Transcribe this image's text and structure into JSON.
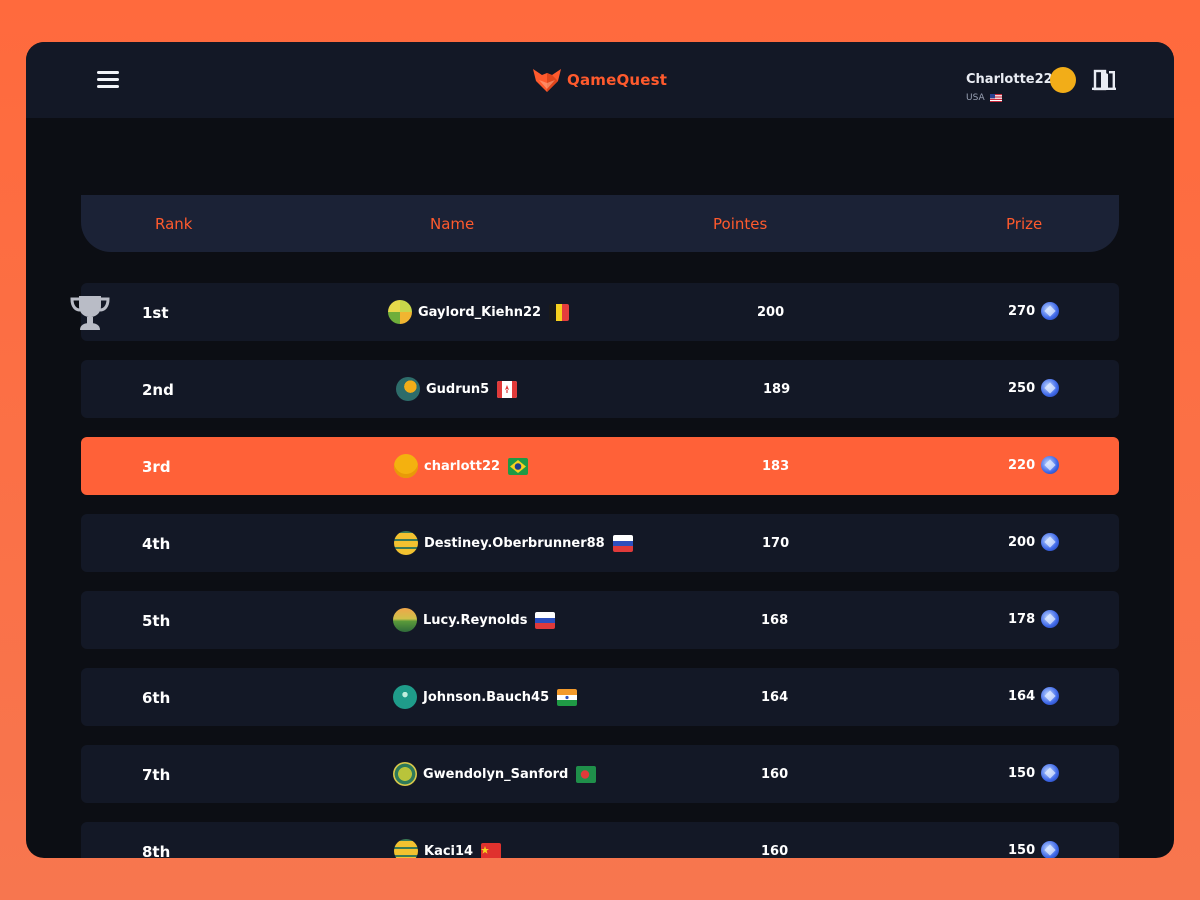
{
  "app": {
    "name": "QameQuest",
    "accent": "#ff5a2d"
  },
  "user": {
    "name": "Charlotte22",
    "country": "USA"
  },
  "table": {
    "headers": [
      "Rank",
      "Name",
      "Pointes",
      "Prize"
    ],
    "rows": [
      {
        "rank": "1st",
        "name": "Gaylord_Kiehn22",
        "points": "200",
        "prize": "270",
        "flag": "belgium"
      },
      {
        "rank": "2nd",
        "name": "Gudrun5",
        "points": "189",
        "prize": "250",
        "flag": "canada"
      },
      {
        "rank": "3rd",
        "name": "charlott22",
        "points": "183",
        "prize": "220",
        "flag": "brazil"
      },
      {
        "rank": "4th",
        "name": "Destiney.Oberbrunner88",
        "points": "170",
        "prize": "200",
        "flag": "russia"
      },
      {
        "rank": "5th",
        "name": "Lucy.Reynolds",
        "points": "168",
        "prize": "178",
        "flag": "russia"
      },
      {
        "rank": "6th",
        "name": "Johnson.Bauch45",
        "points": "164",
        "prize": "164",
        "flag": "india"
      },
      {
        "rank": "7th",
        "name": "Gwendolyn_Sanford",
        "points": "160",
        "prize": "150",
        "flag": "bangladesh"
      },
      {
        "rank": "8th",
        "name": "Kaci14",
        "points": "160",
        "prize": "150",
        "flag": "china"
      }
    ]
  }
}
